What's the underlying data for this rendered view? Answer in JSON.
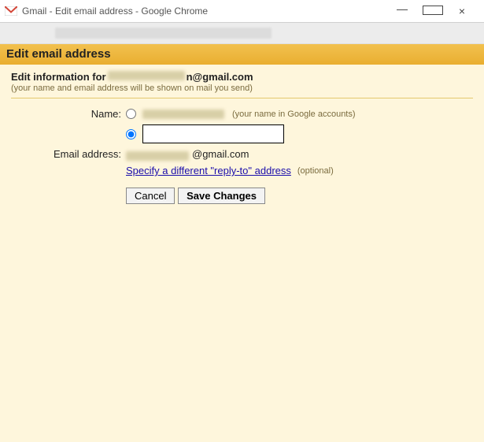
{
  "window": {
    "title": "Gmail - Edit email address - Google Chrome"
  },
  "header": {
    "title": "Edit email address"
  },
  "info": {
    "prefix": "Edit information for ",
    "email_suffix": "n@gmail.com",
    "hint": "(your name and email address will be shown on mail you send)"
  },
  "form": {
    "name_label": "Name:",
    "google_name_hint": "(your name in Google accounts)",
    "name_input_value": "",
    "email_label": "Email address:",
    "email_suffix": "@gmail.com",
    "reply_to_link": "Specify a different \"reply-to\" address",
    "reply_to_optional": "(optional)"
  },
  "buttons": {
    "cancel": "Cancel",
    "save": "Save Changes"
  }
}
